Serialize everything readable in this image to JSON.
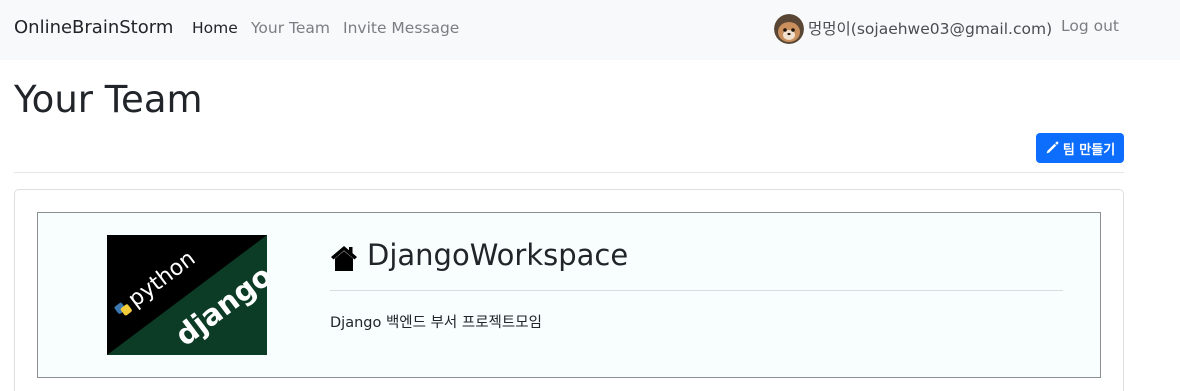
{
  "navbar": {
    "brand": "OnlineBrainStorm",
    "links": [
      {
        "label": "Home"
      },
      {
        "label": "Your Team"
      },
      {
        "label": "Invite Message"
      }
    ],
    "user": "멍멍이(sojaehwe03@gmail.com)",
    "logout": "Log out"
  },
  "page": {
    "title": "Your Team",
    "create_button": "팀 만들기"
  },
  "teams": [
    {
      "name": "DjangoWorkspace",
      "description": "Django 백엔드 부서 프로젝트모임",
      "image_text_top": "python",
      "image_text_bottom": "django"
    }
  ],
  "colors": {
    "primary": "#0d6efd",
    "navbar_bg": "#f8f9fa",
    "django_green": "#0c3c26"
  }
}
